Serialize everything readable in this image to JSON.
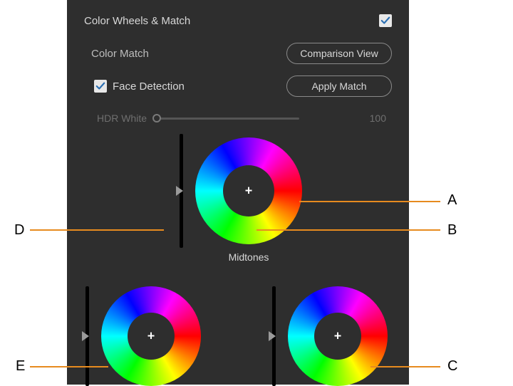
{
  "panel": {
    "title": "Color Wheels & Match",
    "enabled": true
  },
  "colorMatch": {
    "label": "Color Match",
    "comparisonBtn": "Comparison View",
    "faceDetection": {
      "checked": true,
      "label": "Face Detection"
    },
    "applyBtn": "Apply Match"
  },
  "hdrWhite": {
    "label": "HDR White",
    "value": "100",
    "position": 0
  },
  "wheels": {
    "main": {
      "label": "Midtones"
    }
  },
  "callouts": {
    "A": "A",
    "B": "B",
    "C": "C",
    "D": "D",
    "E": "E"
  }
}
